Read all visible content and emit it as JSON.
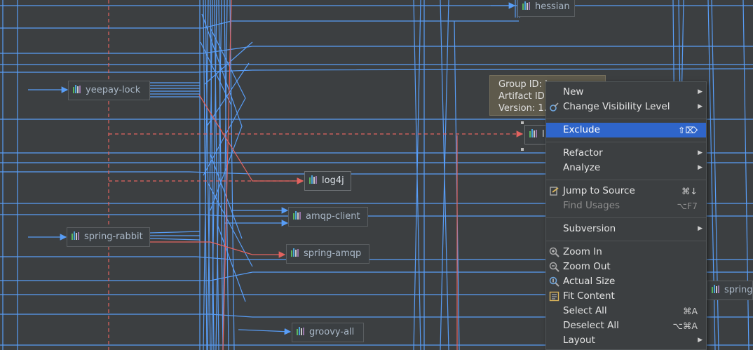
{
  "nodes": {
    "hessian": "hessian",
    "yeepay_lock": "yeepay-lock",
    "log4j": "log4j",
    "amqp_client": "amqp-client",
    "spring_rabbit": "spring-rabbit",
    "spring_amqp": "spring-amqp",
    "groovy_all": "groovy-all",
    "selected_partial": "l",
    "spring_partial": "spring-"
  },
  "tooltip": {
    "line1": "Group ID: l",
    "line2": "Artifact ID:",
    "line3": "Version: 1."
  },
  "context_menu": {
    "items": [
      {
        "label": "New",
        "submenu": true
      },
      {
        "label": "Change Visibility Level",
        "submenu": true,
        "icon": "visibility-icon"
      },
      {
        "label": "Exclude",
        "shortcut": "⇧⌦",
        "selected": true
      },
      {
        "label": "Refactor",
        "submenu": true
      },
      {
        "label": "Analyze",
        "submenu": true
      },
      {
        "label": "Jump to Source",
        "shortcut": "⌘↓",
        "icon": "jump-to-source-icon"
      },
      {
        "label": "Find Usages",
        "shortcut": "⌥F7",
        "disabled": true
      },
      {
        "label": "Subversion",
        "submenu": true
      },
      {
        "label": "Zoom In",
        "icon": "zoom-in-icon"
      },
      {
        "label": "Zoom Out",
        "icon": "zoom-out-icon"
      },
      {
        "label": "Actual Size",
        "icon": "actual-size-icon"
      },
      {
        "label": "Fit Content",
        "icon": "fit-content-icon"
      },
      {
        "label": "Select All",
        "shortcut": "⌘A"
      },
      {
        "label": "Deselect All",
        "shortcut": "⌥⌘A"
      },
      {
        "label": "Layout",
        "submenu": true
      }
    ]
  },
  "colors": {
    "background": "#3c3f41",
    "edge": "#589df6",
    "conflict_edge": "#e2635f",
    "menu_selected": "#2f65ca",
    "annotation_arrow": "#e8251f"
  }
}
